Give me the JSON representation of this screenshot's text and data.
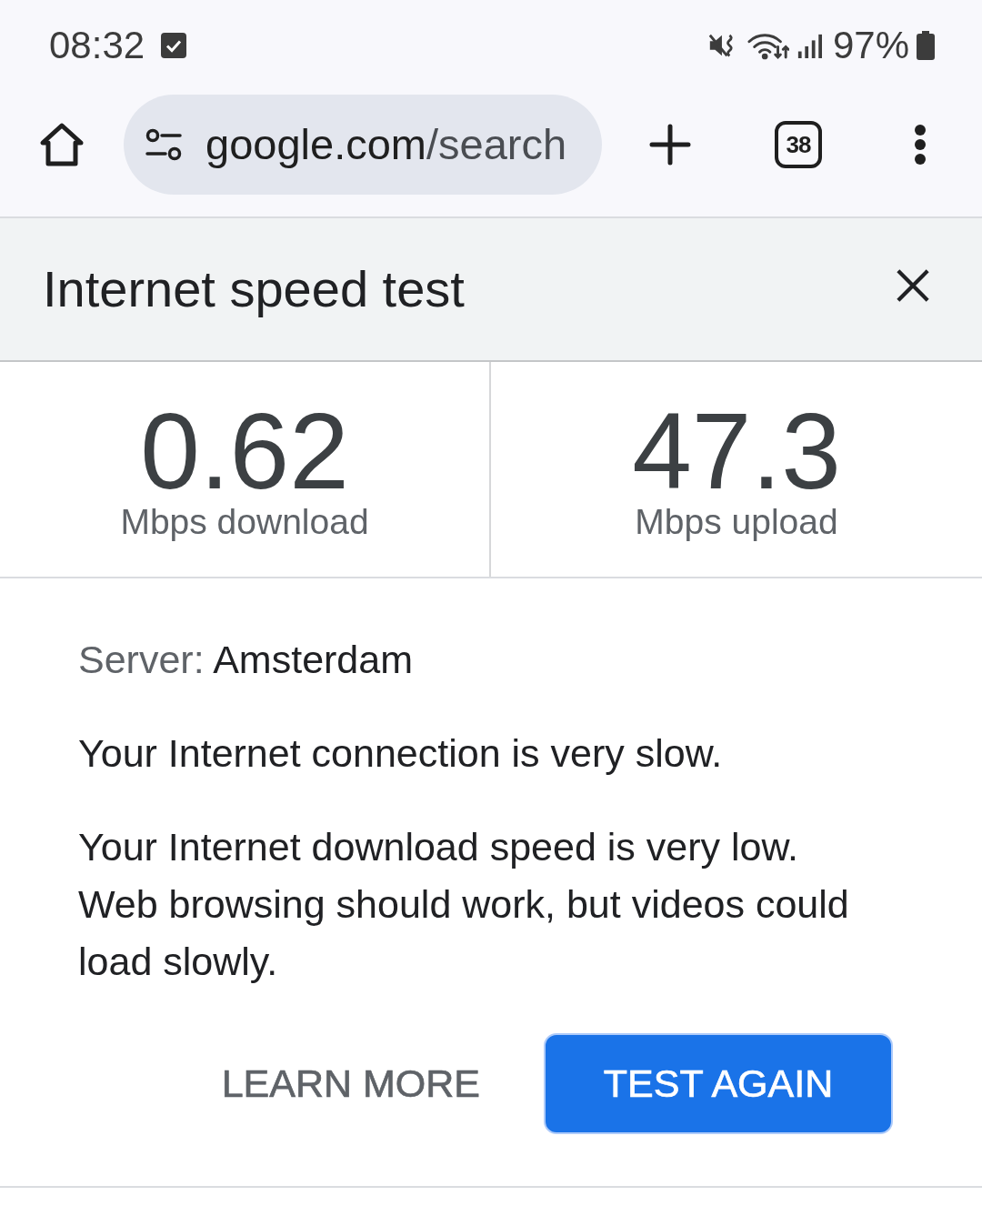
{
  "status_bar": {
    "time": "08:32",
    "battery_text": "97%"
  },
  "toolbar": {
    "url_host": "google.com",
    "url_path": "/search",
    "tab_count": "38"
  },
  "speed_test": {
    "title": "Internet speed test",
    "results": [
      {
        "value": "0.62",
        "unit": "Mbps download"
      },
      {
        "value": "47.3",
        "unit": "Mbps upload"
      }
    ],
    "server": {
      "label": "Server:",
      "value": "Amsterdam"
    },
    "messages": [
      "Your Internet connection is very slow.",
      "Your Internet download speed is very low. Web browsing should work, but videos could load slowly."
    ],
    "buttons": [
      {
        "label": "LEARN MORE",
        "kind": "text"
      },
      {
        "label": "TEST AGAIN",
        "kind": "filled"
      }
    ]
  }
}
